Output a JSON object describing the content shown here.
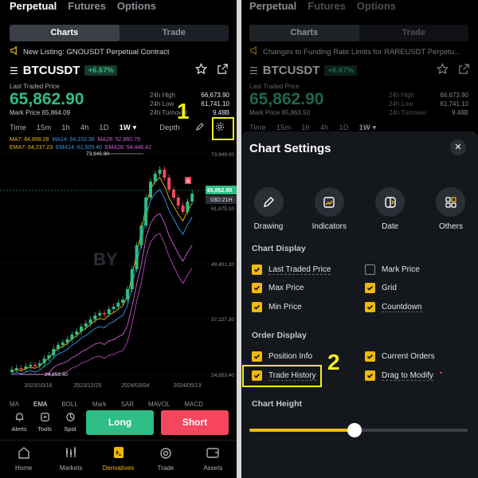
{
  "left": {
    "top_tabs": [
      "Perpetual",
      "Futures",
      "Options"
    ],
    "segmented": [
      "Charts",
      "Trade"
    ],
    "notice": "New Listing: GNOUSDT Perpetual Contract",
    "symbol": "BTCUSDT",
    "change": "+6.67%",
    "last_traded_label": "Last Traded Price",
    "price": "65,862.90",
    "mark_price": "Mark Price 65,864.09",
    "stats": [
      {
        "k": "24h High",
        "v": "66,673.90"
      },
      {
        "k": "24h Low",
        "v": "61,741.10"
      },
      {
        "k": "24h Turnover",
        "v": "9.48B"
      }
    ],
    "timeframes": [
      "Time",
      "15m",
      "1h",
      "4h",
      "1D",
      "1W"
    ],
    "timeframe_active": "1W",
    "depth": "Depth",
    "ma_row1": [
      "MA7: 64,898.28",
      "MA14: 64,103.38",
      "MA28: 52,860.79"
    ],
    "ma_row2": [
      "EMA7: 64,237.23",
      "EMA14: 61,509.40",
      "EMA28: 54,446.42"
    ],
    "chart_labels": {
      "high_marker": "73,949.00",
      "low_marker": "24,853.40",
      "current_price": "65,862.90",
      "countdown": "03D:21H",
      "y_ticks": [
        "73,949.00",
        "61,675.10",
        "49,401.20",
        "37,127.30",
        "24,853.40"
      ],
      "x_ticks": [
        "2023/10/16",
        "2023/12/25",
        "2024/03/04",
        "2024/05/13"
      ],
      "s_badge": "S",
      "watermark": "BY"
    },
    "indicator_tabs": [
      "MA",
      "EMA",
      "BOLL",
      "Mark",
      "SAR",
      "MAVOL",
      "MACD"
    ],
    "small_buttons": [
      "Alerts",
      "Tools",
      "Spot"
    ],
    "long": "Long",
    "short": "Short",
    "nav": [
      "Home",
      "Markets",
      "Derivatives",
      "Trade",
      "Assets"
    ],
    "nav_active": "Derivatives",
    "callout": "1"
  },
  "right": {
    "top_tabs": [
      "Perpetual",
      "Futures",
      "Options"
    ],
    "segmented": [
      "Charts",
      "Trade"
    ],
    "notice": "Changes to Funding  Rate Limits for RAREUSDT Perpetu...",
    "symbol": "BTCUSDT",
    "change": "+6.67%",
    "last_traded_label": "Last Traded Price",
    "price": "65,862.90",
    "mark_price": "Mark Price 65,863.50",
    "stats": [
      {
        "k": "24h High",
        "v": "66,673.90"
      },
      {
        "k": "24h Low",
        "v": "61,741.10"
      },
      {
        "k": "24h Turnover",
        "v": "9.48B"
      }
    ],
    "timeframes": [
      "Time",
      "15m",
      "1h",
      "4h",
      "1D",
      "1W"
    ],
    "settings_title": "Chart Settings",
    "categories": [
      "Drawing",
      "Indicators",
      "Date",
      "Others"
    ],
    "chart_display_title": "Chart Display",
    "chart_display": [
      {
        "label": "Last Traded Price",
        "checked": true
      },
      {
        "label": "Mark Price",
        "checked": false
      },
      {
        "label": "Max Price",
        "checked": true
      },
      {
        "label": "Grid",
        "checked": true
      },
      {
        "label": "Min Price",
        "checked": true
      },
      {
        "label": "Countdown",
        "checked": true
      }
    ],
    "order_display_title": "Order Display",
    "order_display": [
      {
        "label": "Position Info",
        "checked": true
      },
      {
        "label": "Current Orders",
        "checked": true
      },
      {
        "label": "Trade History",
        "checked": true
      },
      {
        "label": "Drag to Modify",
        "checked": true
      }
    ],
    "chart_height_title": "Chart Height",
    "chart_height_level": 0.48,
    "callout": "2"
  },
  "colors": {
    "up": "#2ebd85",
    "down": "#f6465d",
    "accent": "#f0b90b",
    "callout": "#f6ef1a"
  },
  "icons": [
    "bell-icon",
    "menu-icon",
    "star-icon",
    "share-icon",
    "pencil-icon",
    "gear-icon",
    "close-icon",
    "alerts-icon",
    "tools-icon",
    "spot-icon",
    "home-icon",
    "markets-icon",
    "derivatives-icon",
    "trade-icon",
    "assets-icon",
    "drawing-icon",
    "indicators-icon",
    "date-icon",
    "others-icon"
  ]
}
